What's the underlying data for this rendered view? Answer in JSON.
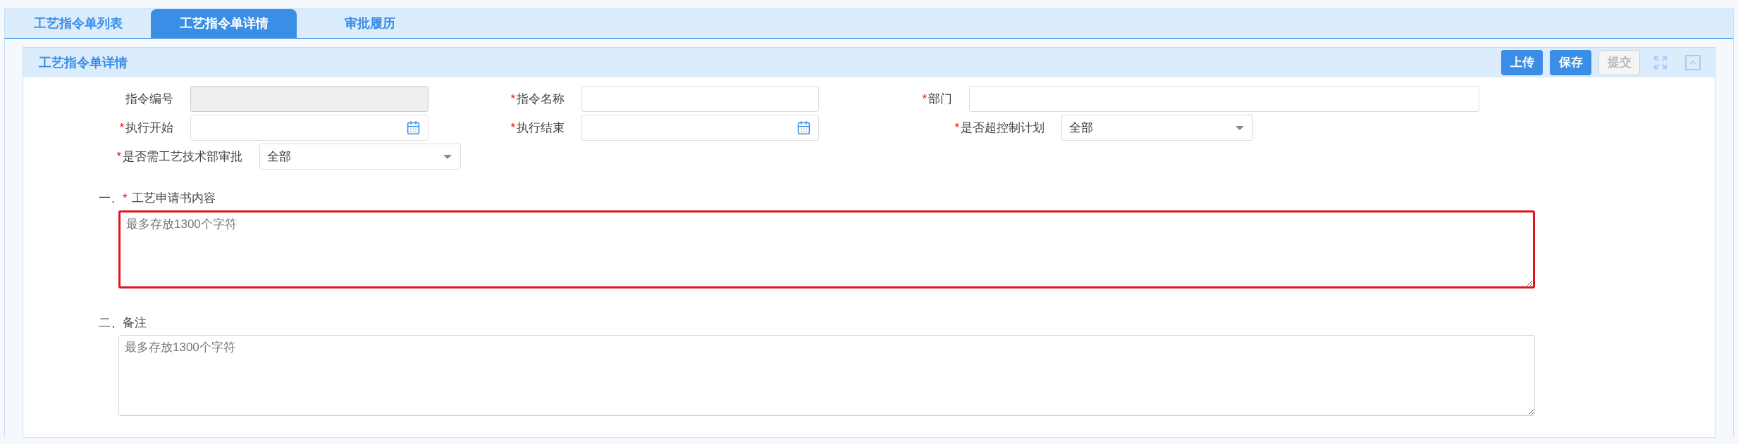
{
  "tabs": [
    {
      "label": "工艺指令单列表",
      "selected": false
    },
    {
      "label": "工艺指令单详情",
      "selected": true
    },
    {
      "label": "审批履历",
      "selected": false
    }
  ],
  "panel": {
    "title": "工艺指令单详情",
    "buttons": [
      {
        "label": "上传",
        "disabled": false
      },
      {
        "label": "保存",
        "disabled": false
      },
      {
        "label": "提交",
        "disabled": true
      }
    ]
  },
  "form_rows": [
    [
      {
        "label": "指令编号",
        "kind": "text",
        "disabled": true
      },
      {
        "label": "指令名称",
        "required_mark": "*",
        "kind": "text",
        "disabled": false
      },
      {
        "label": "部门",
        "required_mark": "*",
        "kind": "text",
        "disabled": false
      }
    ],
    [
      {
        "label": "执行开始",
        "required_mark": "*",
        "kind": "date",
        "disabled": false
      },
      {
        "label": "执行结束",
        "required_mark": "*",
        "kind": "date",
        "disabled": false
      },
      {
        "label": "是否超控制计划",
        "required_mark": "*",
        "kind": "select",
        "value": "全部",
        "disabled": false
      }
    ],
    [
      {
        "label": "是否需工艺技术部审批",
        "required_mark": "*",
        "kind": "select",
        "value": "全部",
        "disabled": false
      }
    ]
  ],
  "sections": [
    {
      "number": "一、",
      "required_mark": "*",
      "label": "工艺申请书内容",
      "placeholder": "最多存放1300个字符",
      "invalid": true
    },
    {
      "number": "二、",
      "label": "备注",
      "placeholder": "最多存放1300个字符",
      "invalid": false
    }
  ]
}
